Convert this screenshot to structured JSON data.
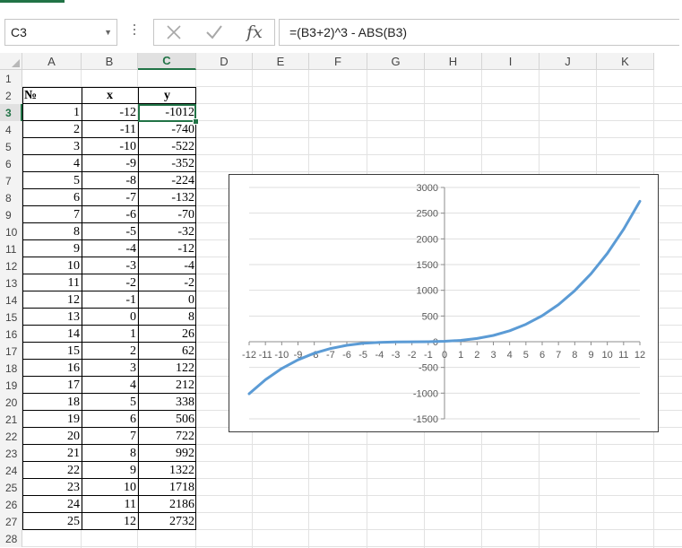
{
  "name_box": {
    "value": "C3"
  },
  "formula_bar": {
    "formula": "=(B3+2)^3 - ABS(B3)",
    "fx_label": "fx"
  },
  "columns": [
    "A",
    "B",
    "C",
    "D",
    "E",
    "F",
    "G",
    "H",
    "I",
    "J",
    "K"
  ],
  "selected_column": "C",
  "rows": [
    "1",
    "2",
    "3",
    "4",
    "5",
    "6",
    "7",
    "8",
    "9",
    "10",
    "11",
    "12",
    "13",
    "14",
    "15",
    "16",
    "17",
    "18",
    "19",
    "20",
    "21",
    "22",
    "23",
    "24",
    "25",
    "26",
    "27",
    "28"
  ],
  "selected_row": "3",
  "table": {
    "headers": [
      "№",
      "x",
      "y"
    ],
    "rows": [
      [
        "1",
        "-12",
        "-1012"
      ],
      [
        "2",
        "-11",
        "-740"
      ],
      [
        "3",
        "-10",
        "-522"
      ],
      [
        "4",
        "-9",
        "-352"
      ],
      [
        "5",
        "-8",
        "-224"
      ],
      [
        "6",
        "-7",
        "-132"
      ],
      [
        "7",
        "-6",
        "-70"
      ],
      [
        "8",
        "-5",
        "-32"
      ],
      [
        "9",
        "-4",
        "-12"
      ],
      [
        "10",
        "-3",
        "-4"
      ],
      [
        "11",
        "-2",
        "-2"
      ],
      [
        "12",
        "-1",
        "0"
      ],
      [
        "13",
        "0",
        "8"
      ],
      [
        "14",
        "1",
        "26"
      ],
      [
        "15",
        "2",
        "62"
      ],
      [
        "16",
        "3",
        "122"
      ],
      [
        "17",
        "4",
        "212"
      ],
      [
        "18",
        "5",
        "338"
      ],
      [
        "19",
        "6",
        "506"
      ],
      [
        "20",
        "7",
        "722"
      ],
      [
        "21",
        "8",
        "992"
      ],
      [
        "22",
        "9",
        "1322"
      ],
      [
        "23",
        "10",
        "1718"
      ],
      [
        "24",
        "11",
        "2186"
      ],
      [
        "25",
        "12",
        "2732"
      ]
    ]
  },
  "colors": {
    "accent": "#217346",
    "series": "#5b9bd5"
  },
  "chart_data": {
    "type": "line",
    "x": [
      -12,
      -11,
      -10,
      -9,
      -8,
      -7,
      -6,
      -5,
      -4,
      -3,
      -2,
      -1,
      0,
      1,
      2,
      3,
      4,
      5,
      6,
      7,
      8,
      9,
      10,
      11,
      12
    ],
    "series": [
      {
        "values": [
          -1012,
          -740,
          -522,
          -352,
          -224,
          -132,
          -70,
          -32,
          -12,
          -4,
          -2,
          0,
          8,
          26,
          62,
          122,
          212,
          338,
          506,
          722,
          992,
          1322,
          1718,
          2186,
          2732
        ]
      }
    ],
    "x_tick_labels": [
      "-12",
      "-11",
      "-10",
      "-9",
      "-8",
      "-7",
      "-6",
      "-5",
      "-4",
      "-3",
      "-2",
      "-1",
      "0",
      "1",
      "2",
      "3",
      "4",
      "5",
      "6",
      "7",
      "8",
      "9",
      "10",
      "11",
      "12"
    ],
    "y_tick_labels": [
      "3000",
      "2500",
      "2000",
      "1500",
      "1000",
      "500",
      "0",
      "-500",
      "-1000",
      "-1500"
    ],
    "xlim": [
      -12,
      12
    ],
    "ylim": [
      -1500,
      3000
    ],
    "title": "",
    "xlabel": "",
    "ylabel": "",
    "grid": true,
    "legend": "none"
  }
}
